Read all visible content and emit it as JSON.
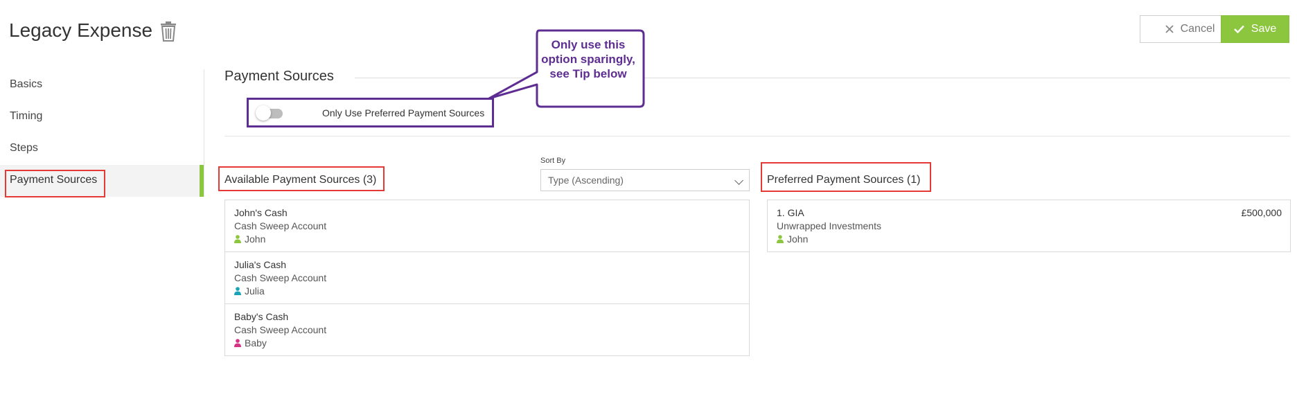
{
  "header": {
    "title": "Legacy Expense",
    "delete_icon": "trash-icon",
    "cancel_label": "Cancel",
    "save_label": "Save",
    "colors": {
      "save_bg": "#8cc63f",
      "accent_purple": "#5e2d91",
      "highlight_red": "#e53935"
    }
  },
  "sidebar": {
    "items": [
      {
        "label": "Basics",
        "active": false
      },
      {
        "label": "Timing",
        "active": false
      },
      {
        "label": "Steps",
        "active": false
      },
      {
        "label": "Payment Sources",
        "active": true
      }
    ]
  },
  "main": {
    "section_title": "Payment Sources",
    "toggle": {
      "label": "Only Use Preferred Payment Sources",
      "on": false
    },
    "callout": "Only use this option sparingly, see Tip below",
    "sort": {
      "label": "Sort By",
      "value": "Type (Ascending)"
    },
    "available": {
      "title": "Available Payment Sources (3)",
      "items": [
        {
          "name": "John's Cash",
          "type": "Cash Sweep Account",
          "owner": "John",
          "owner_color": "#8cc63f"
        },
        {
          "name": "Julia's Cash",
          "type": "Cash Sweep Account",
          "owner": "Julia",
          "owner_color": "#1aa3b8"
        },
        {
          "name": "Baby's Cash",
          "type": "Cash Sweep Account",
          "owner": "Baby",
          "owner_color": "#d63384"
        }
      ]
    },
    "preferred": {
      "title": "Preferred Payment Sources (1)",
      "items": [
        {
          "name": "1. GIA",
          "type": "Unwrapped Investments",
          "owner": "John",
          "owner_color": "#8cc63f",
          "amount": "£500,000"
        }
      ]
    }
  }
}
